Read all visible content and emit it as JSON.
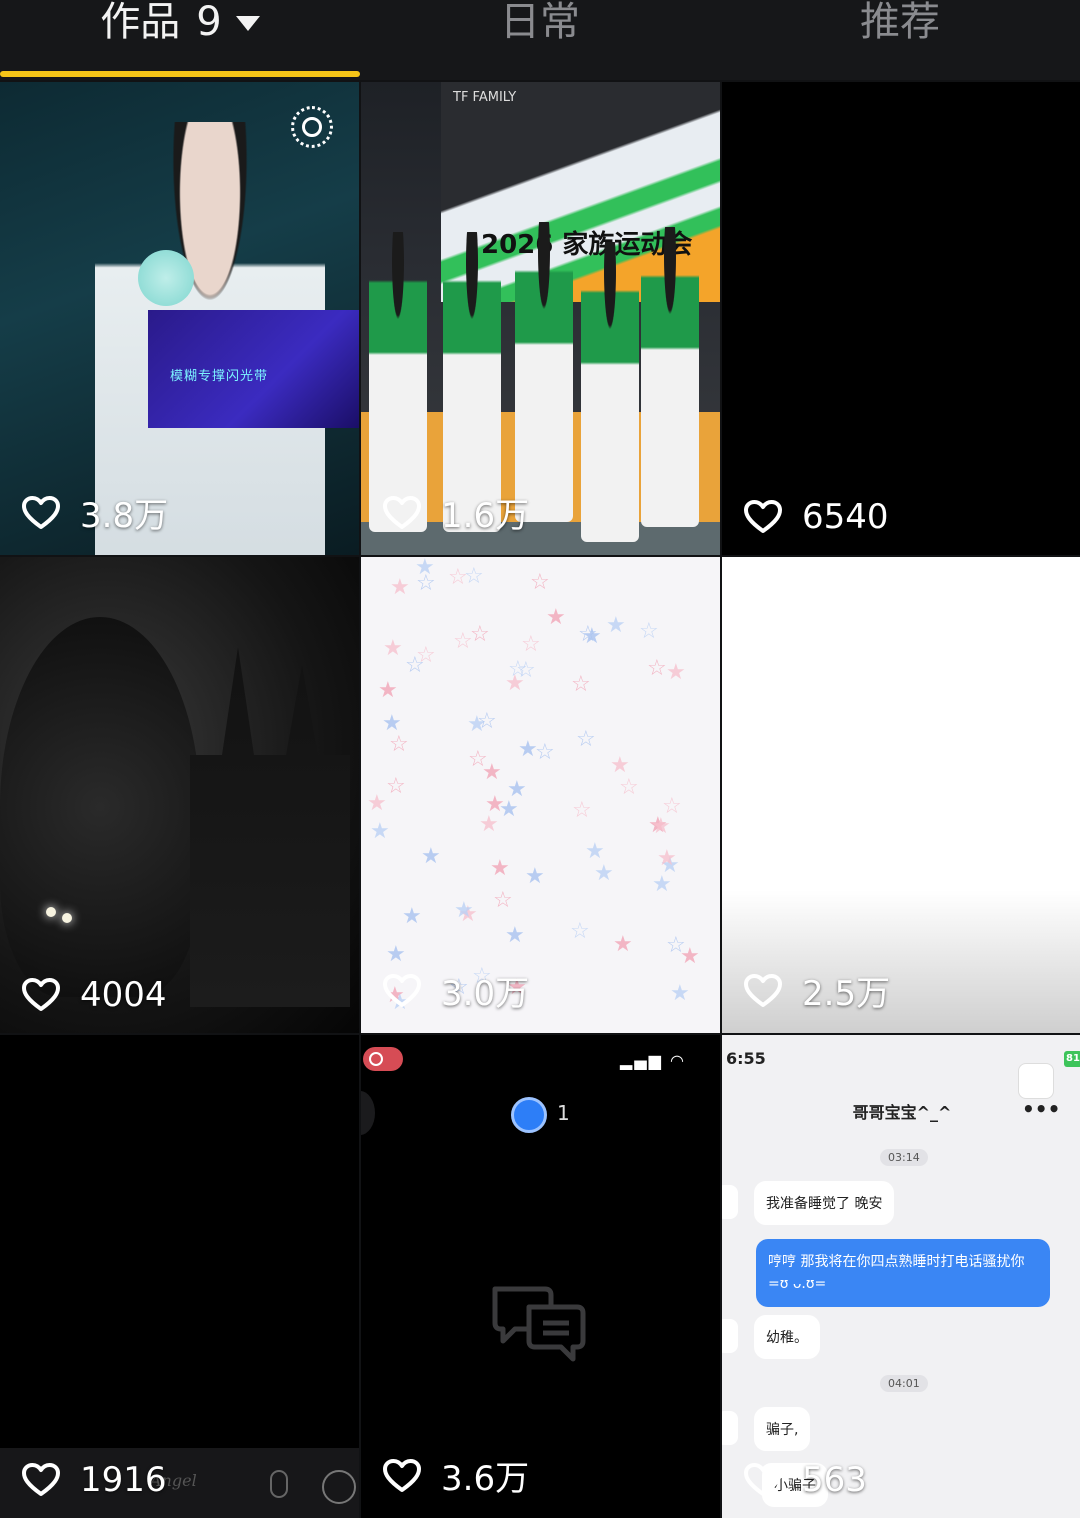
{
  "tabs": [
    {
      "label": "作品",
      "count": "9",
      "active": true
    },
    {
      "label": "日常",
      "active": false
    },
    {
      "label": "推荐",
      "active": false
    }
  ],
  "colors": {
    "accent": "#f5c518",
    "background": "#111214"
  },
  "grid": [
    {
      "likes": "3.8万",
      "screen_text": "模糊专撑闪光带"
    },
    {
      "likes": "1.6万",
      "banner": "2026 家族运动会",
      "logo": "TF FAMILY"
    },
    {
      "likes": "6540"
    },
    {
      "likes": "4004"
    },
    {
      "likes": "3.0万"
    },
    {
      "likes": "2.5万"
    },
    {
      "likes": "1916",
      "input_hint": "Angel"
    },
    {
      "likes": "3.6万",
      "comment_count": "1"
    },
    {
      "likes": "563",
      "status_time": "6:55",
      "battery": "81",
      "chat_title": "哥哥宝宝^_^",
      "messages": [
        {
          "time": "03:14"
        },
        {
          "text": "我准备睡觉了  晚安",
          "side": "in"
        },
        {
          "text": "哼哼  那我将在你四点熟睡时打电话骚扰你 =ʊ ᴗ.ʊ=",
          "side": "out"
        },
        {
          "text": "幼稚。",
          "side": "in"
        },
        {
          "time": "04:01"
        },
        {
          "text": "骗子,",
          "side": "in"
        },
        {
          "text": "小骗子",
          "side": "in"
        }
      ]
    }
  ]
}
